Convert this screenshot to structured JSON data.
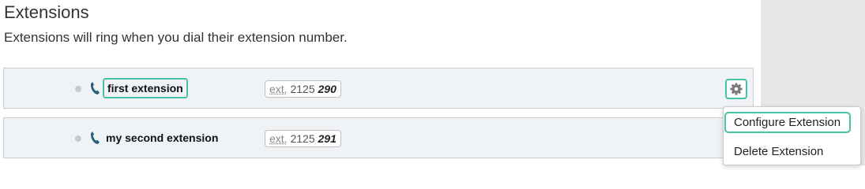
{
  "page": {
    "title": "Extensions",
    "subtitle": "Extensions will ring when you dial their extension number."
  },
  "extensions": [
    {
      "name": "first extension",
      "ext_abbr": "ext.",
      "ext_prefix": "2125",
      "ext_number": "290",
      "status": "offline",
      "icon": "phone-icon"
    },
    {
      "name": "my second extension",
      "ext_abbr": "ext.",
      "ext_prefix": "2125",
      "ext_number": "291",
      "status": "offline",
      "icon": "phone-icon"
    }
  ],
  "actions": {
    "gear_icon": "gear-icon"
  },
  "dropdown": {
    "items": [
      {
        "label": "Configure Extension"
      },
      {
        "label": "Delete Extension"
      }
    ]
  },
  "colors": {
    "highlight": "#46c2a8",
    "row_background": "#f0f3f6",
    "phone_icon": "#2a5e80",
    "side_panel": "#e7e7e6"
  }
}
